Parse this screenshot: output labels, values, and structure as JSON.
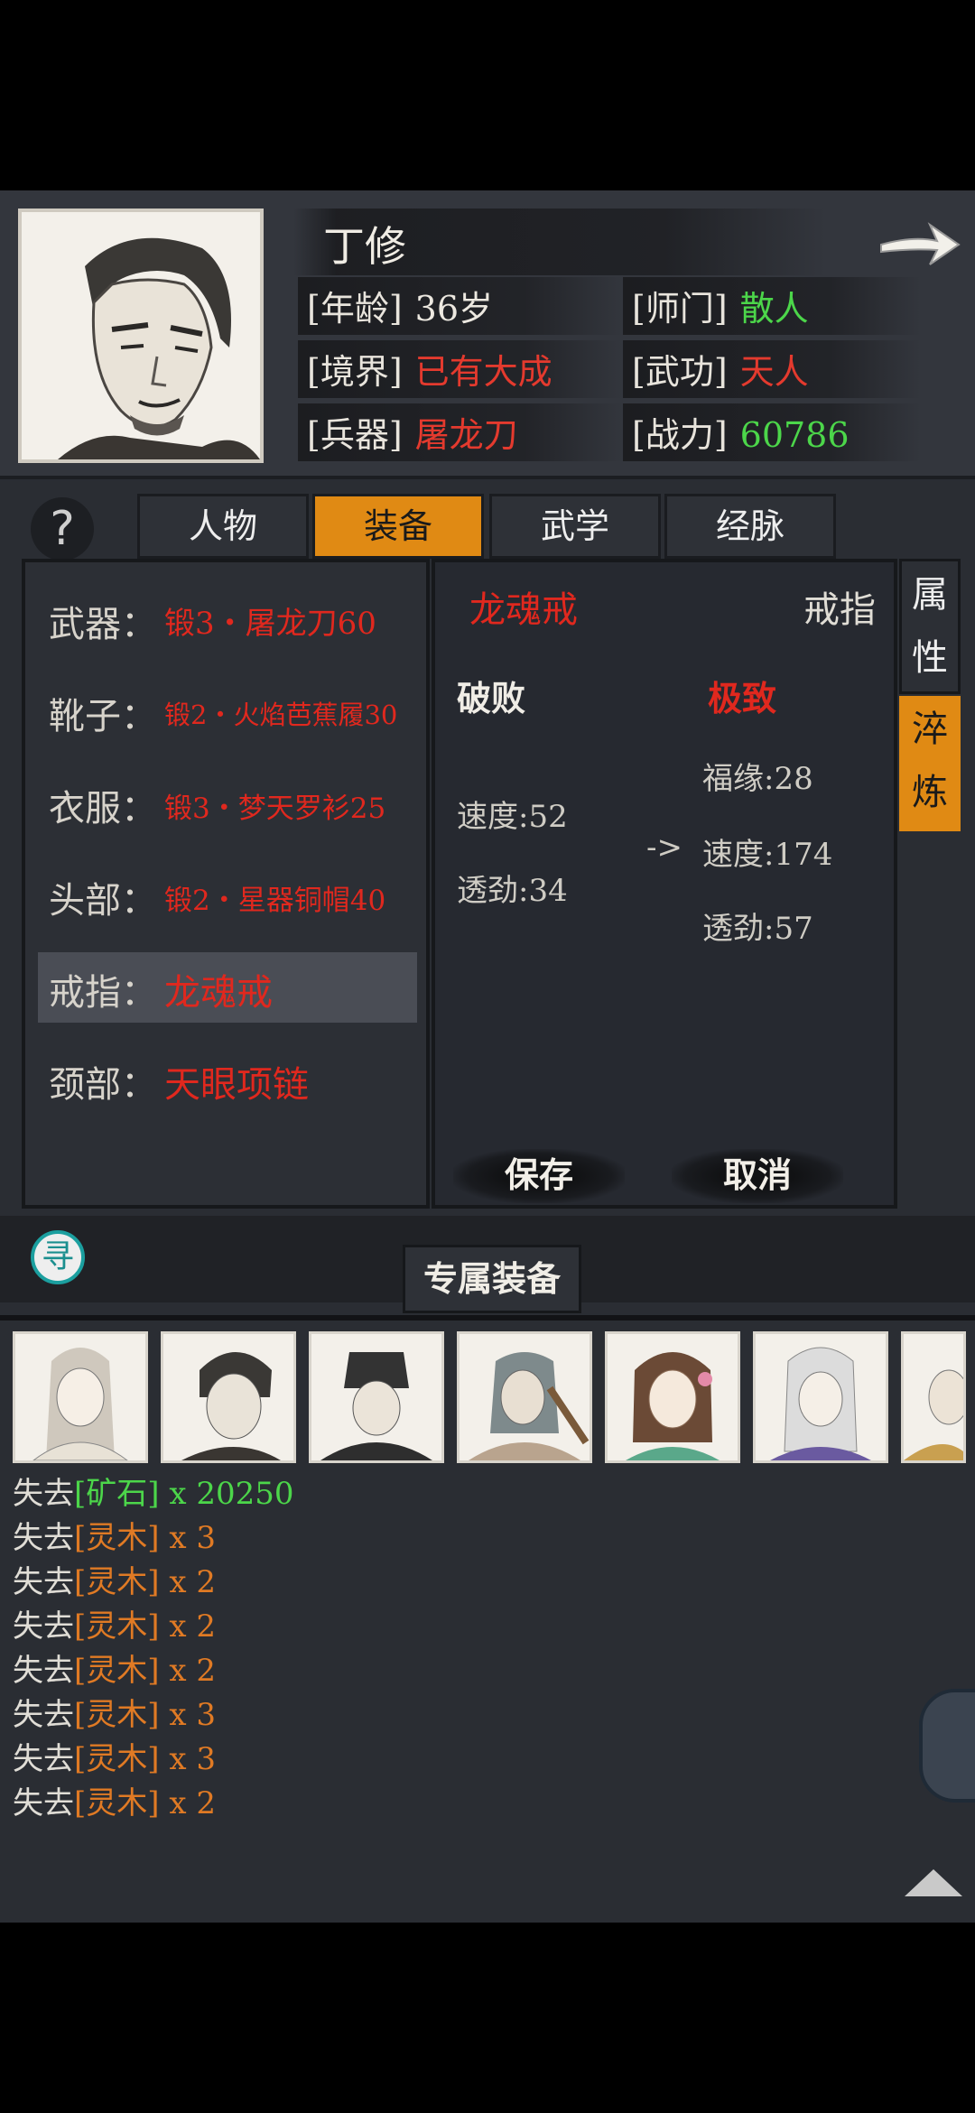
{
  "character": {
    "name": "丁修",
    "stats": [
      {
        "label": "[年龄]",
        "value": "36岁",
        "color": "#ece8e0"
      },
      {
        "label": "[师门]",
        "value": "散人",
        "color": "#4cd64a"
      },
      {
        "label": "[境界]",
        "value": "已有大成",
        "color": "#e43a2e"
      },
      {
        "label": "[武功]",
        "value": "天人",
        "color": "#e43a2e"
      },
      {
        "label": "[兵器]",
        "value": "屠龙刀",
        "color": "#e43a2e"
      },
      {
        "label": "[战力]",
        "value": "60786",
        "color": "#4cd64a"
      }
    ]
  },
  "help_label": "?",
  "tabs": [
    "人物",
    "装备",
    "武学",
    "经脉"
  ],
  "active_tab": "装备",
  "equipment": [
    {
      "label": "武器：",
      "value": "锻3・屠龙刀60"
    },
    {
      "label": "靴子：",
      "value": "锻2・火焰芭蕉履30"
    },
    {
      "label": "衣服：",
      "value": "锻3・梦天罗衫25"
    },
    {
      "label": "头部：",
      "value": "锻2・星器铜帽40"
    },
    {
      "label": "戒指：",
      "value": "龙魂戒",
      "selected": true
    },
    {
      "label": "颈部：",
      "value": "天眼项链"
    }
  ],
  "detail": {
    "item_name": "龙魂戒",
    "item_type": "戒指",
    "from_label": "破败",
    "to_label": "极致",
    "from_attrs": [
      "速度:52",
      "透劲:34"
    ],
    "arrow": "->",
    "to_attrs": [
      "福缘:28",
      "速度:174",
      "透劲:57"
    ],
    "save_label": "保存",
    "cancel_label": "取消"
  },
  "side_tabs": [
    {
      "label": "属性",
      "active": false
    },
    {
      "label": "淬炼",
      "active": true
    }
  ],
  "exclusive_label": "专属装备",
  "search_glyph": "寻",
  "log": [
    {
      "prefix": "失去",
      "item": "[矿石]",
      "qty": " x 20250",
      "color": "green"
    },
    {
      "prefix": "失去",
      "item": "[灵木]",
      "qty": " x 3",
      "color": "orange"
    },
    {
      "prefix": "失去",
      "item": "[灵木]",
      "qty": " x 2",
      "color": "orange"
    },
    {
      "prefix": "失去",
      "item": "[灵木]",
      "qty": " x 2",
      "color": "orange"
    },
    {
      "prefix": "失去",
      "item": "[灵木]",
      "qty": " x 2",
      "color": "orange"
    },
    {
      "prefix": "失去",
      "item": "[灵木]",
      "qty": " x 3",
      "color": "orange"
    },
    {
      "prefix": "失去",
      "item": "[灵木]",
      "qty": " x 3",
      "color": "orange"
    },
    {
      "prefix": "失去",
      "item": "[灵木]",
      "qty": " x 2",
      "color": "orange"
    }
  ],
  "colors": {
    "accent": "#e08a14",
    "red": "#e0281e",
    "green": "#4cd64a",
    "orange": "#e07a24"
  }
}
